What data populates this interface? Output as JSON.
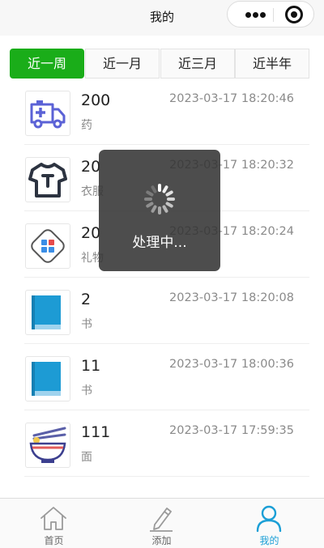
{
  "navbar": {
    "title": "我的"
  },
  "tabs": [
    {
      "label": "近一周",
      "active": true
    },
    {
      "label": "近一月",
      "active": false
    },
    {
      "label": "近三月",
      "active": false
    },
    {
      "label": "近半年",
      "active": false
    }
  ],
  "records": [
    {
      "amount": "200",
      "time": "2023-03-17 18:20:46",
      "category": "药",
      "icon": "ambulance-icon"
    },
    {
      "amount": "20",
      "time": "2023-03-17 18:20:32",
      "category": "衣服",
      "icon": "tshirt-icon"
    },
    {
      "amount": "20",
      "time": "2023-03-17 18:20:24",
      "category": "礼物",
      "icon": "apps-grid-icon"
    },
    {
      "amount": "2",
      "time": "2023-03-17 18:20:08",
      "category": "书",
      "icon": "book-icon"
    },
    {
      "amount": "11",
      "time": "2023-03-17 18:00:36",
      "category": "书",
      "icon": "book-icon"
    },
    {
      "amount": "111",
      "time": "2023-03-17 17:59:35",
      "category": "面",
      "icon": "noodle-bowl-icon"
    }
  ],
  "toast": {
    "text": "处理中..."
  },
  "tabbar": [
    {
      "label": "首页",
      "icon": "home-icon",
      "active": false
    },
    {
      "label": "添加",
      "icon": "pencil-icon",
      "active": false
    },
    {
      "label": "我的",
      "icon": "user-icon",
      "active": true
    }
  ],
  "colors": {
    "accent": "#1aad19",
    "active_tab": "#1b9fd6",
    "muted": "#8a8a8a"
  }
}
